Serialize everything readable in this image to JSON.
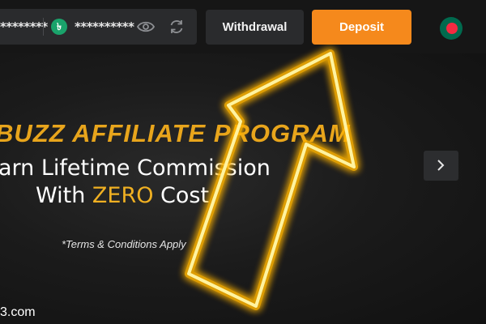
{
  "header": {
    "balance_masked_1": "********",
    "currency_symbol": "৳",
    "balance_masked_2": "**********",
    "withdrawal_label": "Withdrawal",
    "deposit_label": "Deposit",
    "icons": [
      "taka-currency-icon",
      "eye-icon",
      "refresh-icon",
      "bangladesh-flag-icon"
    ]
  },
  "banner": {
    "title": "BUZZ AFFILIATE PROGRAM",
    "line2": "arn Lifetime Commission",
    "line3_prefix": "With ",
    "line3_highlight": "ZERO",
    "line3_suffix": " Cost",
    "terms": "*Terms & Conditions Apply",
    "domain": "3.com",
    "next_icon": "chevron-right-icon"
  },
  "colors": {
    "deposit": "#f5891c",
    "title_gold": "#e8a51c",
    "arrow_glow": "#ffd21a"
  }
}
